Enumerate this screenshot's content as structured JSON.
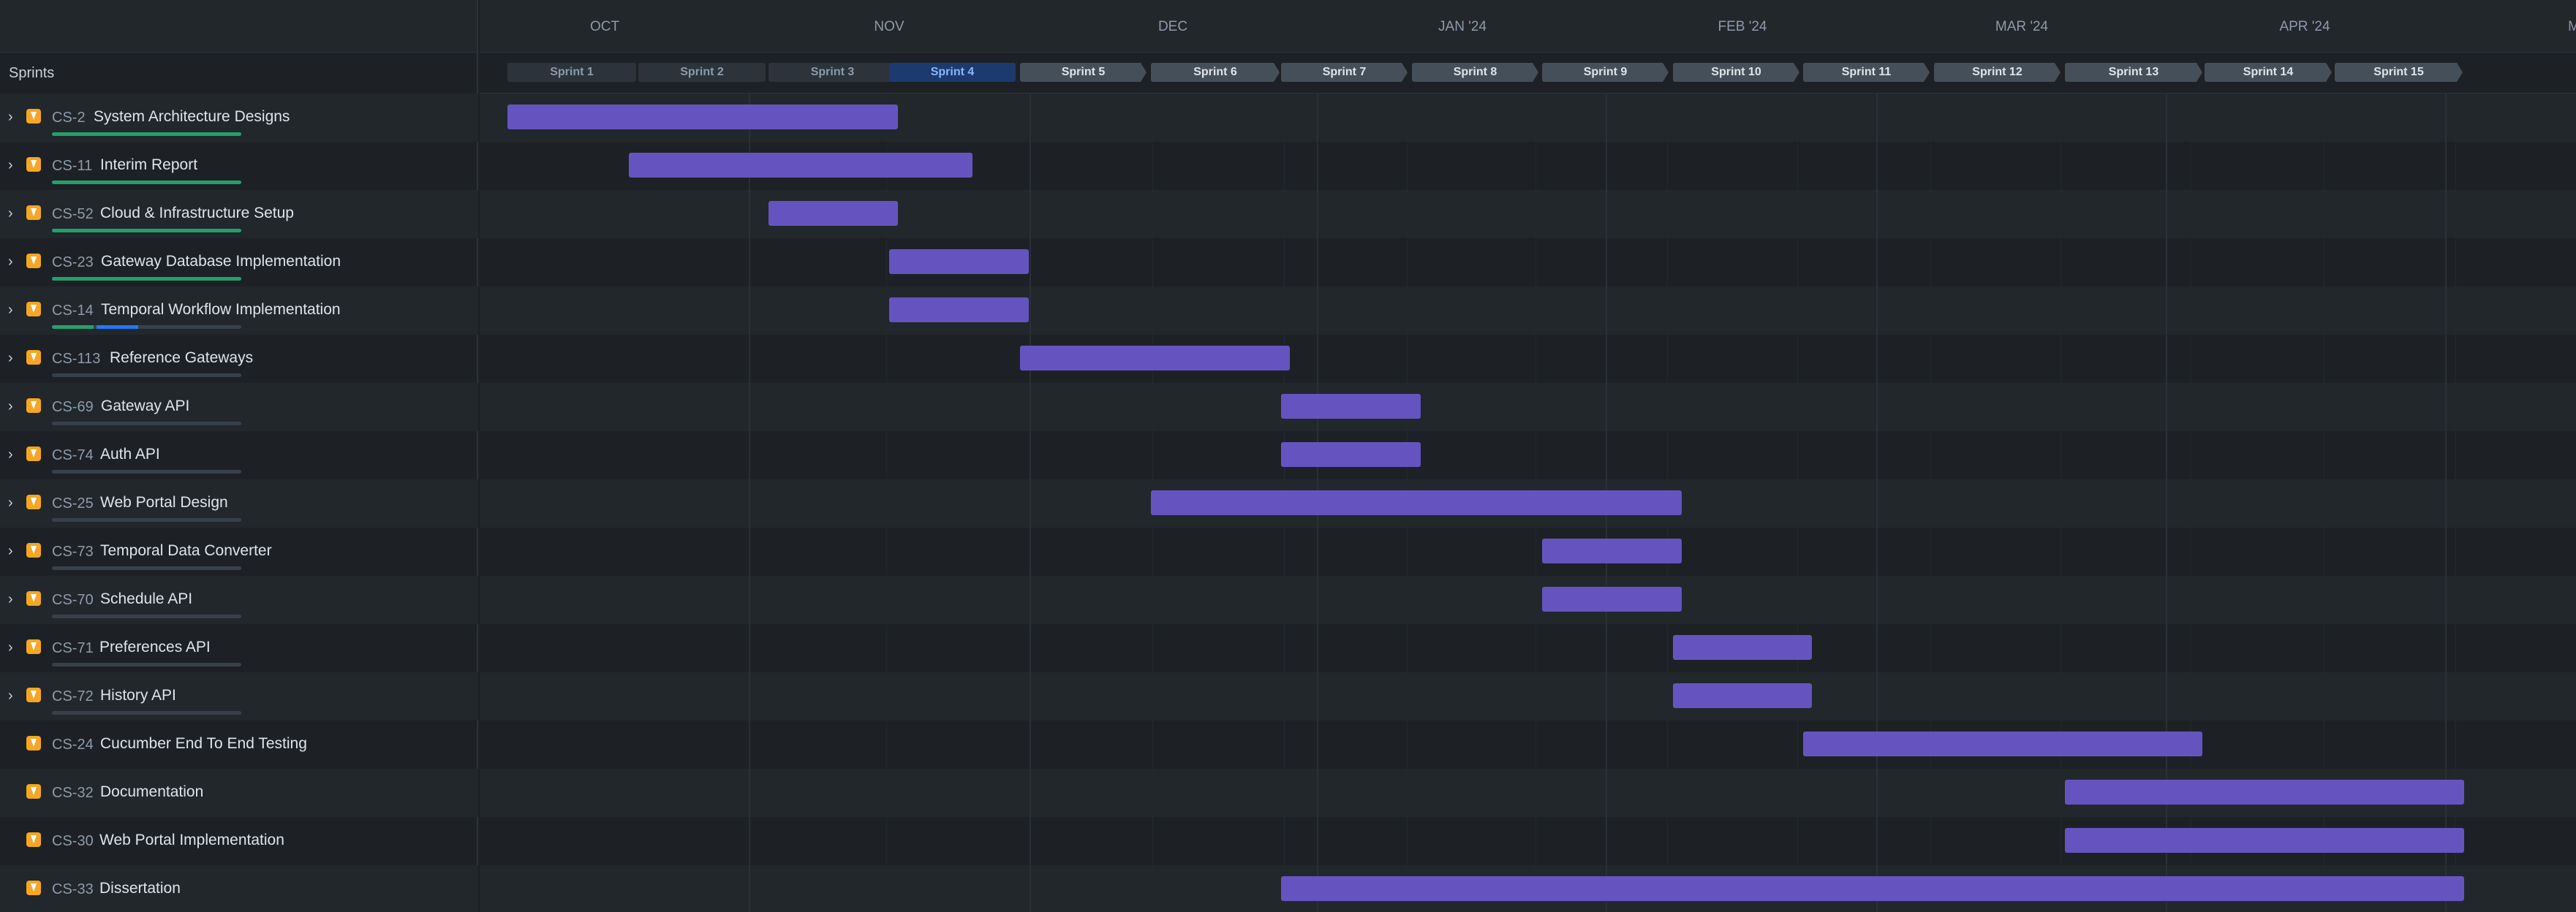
{
  "left_header": {
    "sprints_label": "Sprints"
  },
  "months": [
    {
      "label": "OCT",
      "center": 827,
      "end": 1024
    },
    {
      "label": "NOV",
      "center": 1216,
      "end": 1408
    },
    {
      "label": "DEC",
      "center": 1604,
      "end": 1801
    },
    {
      "label": "JAN '24",
      "center": 2000,
      "end": 2196
    },
    {
      "label": "FEB '24",
      "center": 2383,
      "end": 2566
    },
    {
      "label": "MAR '24",
      "center": 2765,
      "end": 2962
    },
    {
      "label": "APR '24",
      "center": 3152,
      "end": 3344
    },
    {
      "label": "M",
      "center": 3520,
      "end": 3600
    }
  ],
  "sprints": [
    {
      "label": "Sprint 1",
      "state": "done"
    },
    {
      "label": "Sprint 2",
      "state": "done"
    },
    {
      "label": "Sprint 3",
      "state": "done"
    },
    {
      "label": "Sprint 4",
      "state": "active"
    },
    {
      "label": "Sprint 5",
      "state": "next"
    },
    {
      "label": "Sprint 6",
      "state": "next"
    },
    {
      "label": "Sprint 7",
      "state": "next"
    },
    {
      "label": "Sprint 8",
      "state": "next"
    },
    {
      "label": "Sprint 9",
      "state": "next"
    },
    {
      "label": "Sprint 10",
      "state": "next"
    },
    {
      "label": "Sprint 11",
      "state": "next"
    },
    {
      "label": "Sprint 12",
      "state": "next"
    },
    {
      "label": "Sprint 13",
      "state": "next"
    },
    {
      "label": "Sprint 14",
      "state": "next"
    },
    {
      "label": "Sprint 15",
      "state": "next"
    }
  ],
  "epics": [
    {
      "key": "CS-2",
      "title": "System Architecture Designs",
      "expandable": true,
      "done_pct": 100,
      "inprog_pct": 0
    },
    {
      "key": "CS-11",
      "title": "Interim Report",
      "expandable": true,
      "done_pct": 100,
      "inprog_pct": 0
    },
    {
      "key": "CS-52",
      "title": "Cloud & Infrastructure Setup",
      "expandable": true,
      "done_pct": 100,
      "inprog_pct": 0
    },
    {
      "key": "CS-23",
      "title": "Gateway Database Implementation",
      "expandable": true,
      "done_pct": 100,
      "inprog_pct": 0
    },
    {
      "key": "CS-14",
      "title": "Temporal Workflow Implementation",
      "expandable": true,
      "done_pct": 22,
      "inprog_pct": 22
    },
    {
      "key": "CS-113",
      "title": "Reference Gateways",
      "expandable": true,
      "done_pct": 0,
      "inprog_pct": 0
    },
    {
      "key": "CS-69",
      "title": "Gateway API",
      "expandable": true,
      "done_pct": 0,
      "inprog_pct": 0
    },
    {
      "key": "CS-74",
      "title": "Auth API",
      "expandable": true,
      "done_pct": 0,
      "inprog_pct": 0
    },
    {
      "key": "CS-25",
      "title": "Web Portal Design",
      "expandable": true,
      "done_pct": 0,
      "inprog_pct": 0
    },
    {
      "key": "CS-73",
      "title": "Temporal Data Converter",
      "expandable": true,
      "done_pct": 0,
      "inprog_pct": 0
    },
    {
      "key": "CS-70",
      "title": "Schedule API",
      "expandable": true,
      "done_pct": 0,
      "inprog_pct": 0
    },
    {
      "key": "CS-71",
      "title": "Preferences API",
      "expandable": true,
      "done_pct": 0,
      "inprog_pct": 0
    },
    {
      "key": "CS-72",
      "title": "History API",
      "expandable": true,
      "done_pct": 0,
      "inprog_pct": 0
    },
    {
      "key": "CS-24",
      "title": "Cucumber End To End Testing",
      "expandable": false,
      "done_pct": null,
      "inprog_pct": null
    },
    {
      "key": "CS-32",
      "title": "Documentation",
      "expandable": false,
      "done_pct": null,
      "inprog_pct": null
    },
    {
      "key": "CS-30",
      "title": "Web Portal Implementation",
      "expandable": false,
      "done_pct": null,
      "inprog_pct": null
    },
    {
      "key": "CS-33",
      "title": "Dissertation",
      "expandable": false,
      "done_pct": null,
      "inprog_pct": null
    }
  ],
  "colors": {
    "bar": "#6554c0",
    "progress_done": "#22a06b",
    "progress_in_progress": "#1d7afc",
    "epic_icon": "#f5a623",
    "active_sprint": "#1c3a6e"
  },
  "icons": {
    "expand": "chevron-right-icon",
    "epic": "epic-lightning-icon"
  }
}
